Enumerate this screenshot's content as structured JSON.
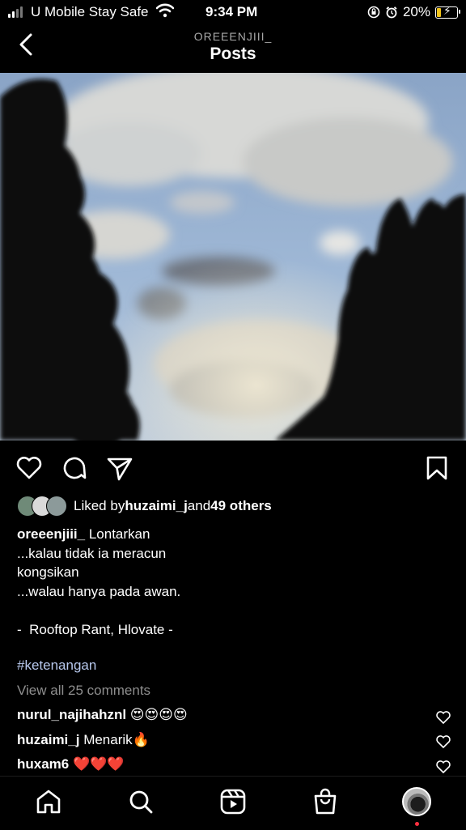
{
  "status_bar": {
    "carrier": "U Mobile Stay Safe",
    "time": "9:34 PM",
    "battery": "20%",
    "battery_level": 0.2,
    "icons": [
      "signal-icon",
      "wifi-icon",
      "screen-rotation-lock-icon",
      "alarm-icon",
      "battery-charging-icon"
    ]
  },
  "header": {
    "username": "OREEENJIII_",
    "title": "Posts"
  },
  "post": {
    "likes": {
      "prefix": "Liked by ",
      "user": "huzaimi_j",
      "middle": " and ",
      "others": "49 others"
    },
    "caption": {
      "username": "oreeenjiii_",
      "text": " Lontarkan\n...kalau tidak ia meracun\nkongsikan\n...walau hanya pada awan.\n\n-  Rooftop Rant, Hlovate -"
    },
    "hashtag": "#ketenangan",
    "view_all_comments": "View all 25 comments",
    "comments": [
      {
        "username": "nurul_najihahznl",
        "text": " 😍😍😍😍"
      },
      {
        "username": "huzaimi_j",
        "text": " Menarik🔥"
      },
      {
        "username": "huxam6",
        "text": " ❤️❤️❤️"
      }
    ]
  },
  "bottom_nav": [
    "home-icon",
    "search-icon",
    "reels-icon",
    "shop-icon",
    "profile-avatar"
  ],
  "colors": {
    "background": "#000000",
    "secondary_text": "#8e8e8e",
    "hashtag": "#b8c9ee",
    "notification_dot": "#ff3040",
    "battery_fill": "#f3c41a"
  }
}
